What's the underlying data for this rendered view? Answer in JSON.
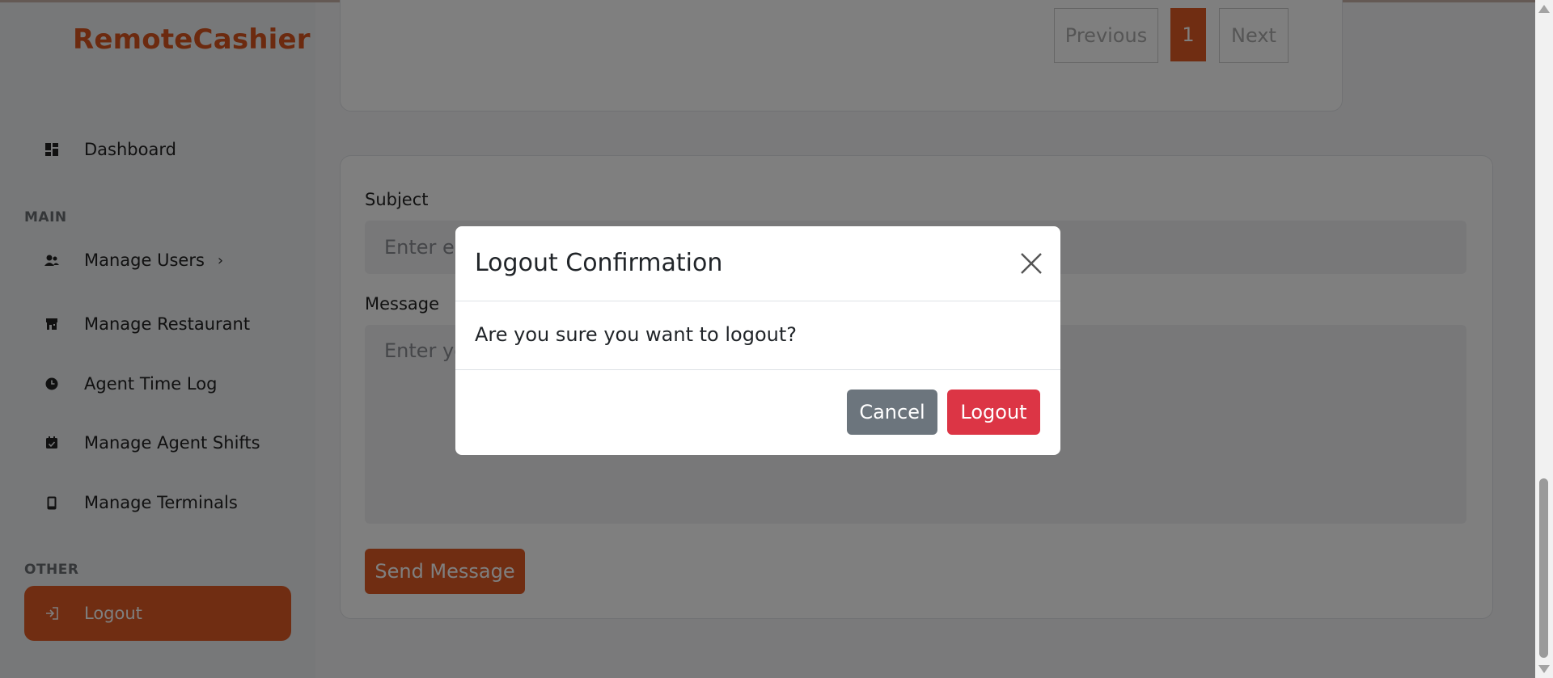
{
  "app": {
    "brand": "RemoteCashier"
  },
  "sidebar": {
    "sections": {
      "main": "MAIN",
      "other": "OTHER"
    },
    "items": [
      {
        "label": "Dashboard",
        "icon": "dashboard-icon"
      },
      {
        "label": "Manage Users",
        "icon": "users-icon",
        "chevron": "›"
      },
      {
        "label": "Manage Restaurant",
        "icon": "restaurant-icon"
      },
      {
        "label": "Agent Time Log",
        "icon": "clock-icon"
      },
      {
        "label": "Manage Agent Shifts",
        "icon": "calendar-check-icon"
      },
      {
        "label": "Manage Terminals",
        "icon": "mobile-icon"
      },
      {
        "label": "Logout",
        "icon": "logout-icon",
        "active": true
      }
    ]
  },
  "pagination": {
    "previous": "Previous",
    "current": "1",
    "next": "Next"
  },
  "form": {
    "subject_label": "Subject",
    "subject_placeholder": "Enter email subject",
    "message_label": "Message",
    "message_placeholder": "Enter your message",
    "send_label": "Send Message"
  },
  "modal": {
    "title": "Logout Confirmation",
    "body": "Are you sure you want to logout?",
    "cancel": "Cancel",
    "confirm": "Logout"
  },
  "colors": {
    "accent": "#e15a24",
    "danger": "#dc3545",
    "secondary": "#6c757d"
  }
}
